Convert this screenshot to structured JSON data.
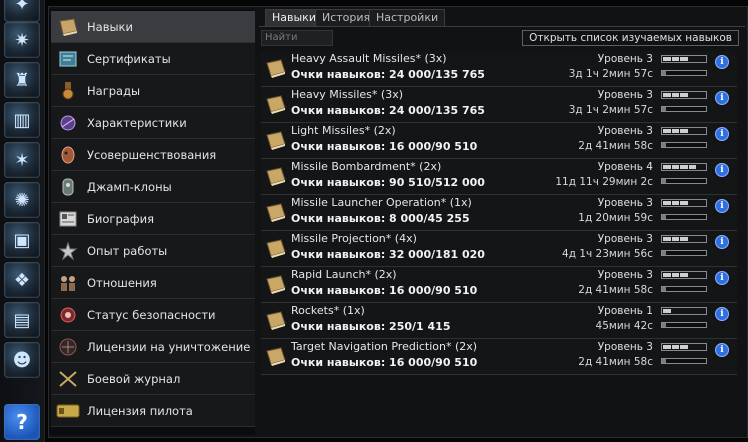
{
  "neocom": {
    "icons": [
      "character-sheet-icon",
      "skills-icon",
      "people-icon",
      "market-icon",
      "agents-icon",
      "star-map-icon",
      "assets-icon",
      "wallet-icon",
      "journal-icon",
      "character-portrait-icon",
      "help-icon"
    ],
    "help_label": "?"
  },
  "sidebar": {
    "items": [
      {
        "label": "Навыки",
        "icon": "skill-book-icon"
      },
      {
        "label": "Сертификаты",
        "icon": "certificate-icon"
      },
      {
        "label": "Награды",
        "icon": "medal-icon"
      },
      {
        "label": "Характеристики",
        "icon": "attributes-icon"
      },
      {
        "label": "Усовершенствования",
        "icon": "augmentations-icon"
      },
      {
        "label": "Джамп-клоны",
        "icon": "jump-clone-icon"
      },
      {
        "label": "Биография",
        "icon": "biography-icon"
      },
      {
        "label": "Опыт работы",
        "icon": "employment-icon"
      },
      {
        "label": "Отношения",
        "icon": "standings-icon"
      },
      {
        "label": "Статус безопасности",
        "icon": "security-status-icon"
      },
      {
        "label": "Лицензии на уничтожение",
        "icon": "kill-rights-icon"
      },
      {
        "label": "Боевой журнал",
        "icon": "combat-log-icon"
      },
      {
        "label": "Лицензия пилота",
        "icon": "pilot-license-icon"
      }
    ]
  },
  "tabs": [
    {
      "label": "Навыки"
    },
    {
      "label": "История"
    },
    {
      "label": "Настройки"
    }
  ],
  "search": {
    "placeholder": "Найти"
  },
  "open_list_button": "Открыть список изучаемых навыков",
  "skills": [
    {
      "name": "Heavy Assault Missiles*  (3x)",
      "points": "Очки навыков: 24 000/135 765",
      "level": "Уровень 3",
      "time": "3д 1ч 2мин 57с",
      "level_num": 3,
      "progress": 0.1
    },
    {
      "name": "Heavy Missiles*  (3x)",
      "points": "Очки навыков: 24 000/135 765",
      "level": "Уровень 3",
      "time": "3д 1ч 2мин 57с",
      "level_num": 3,
      "progress": 0.1
    },
    {
      "name": "Light Missiles*  (2x)",
      "points": "Очки навыков: 16 000/90 510",
      "level": "Уровень 3",
      "time": "2д 41мин 58с",
      "level_num": 3,
      "progress": 0.1
    },
    {
      "name": "Missile Bombardment*  (2x)",
      "points": "Очки навыков: 90 510/512 000",
      "level": "Уровень 4",
      "time": "11д 11ч 29мин 2с",
      "level_num": 4,
      "progress": 0.1
    },
    {
      "name": "Missile Launcher Operation*  (1x)",
      "points": "Очки навыков: 8 000/45 255",
      "level": "Уровень 3",
      "time": "1д 20мин 59с",
      "level_num": 3,
      "progress": 0.1
    },
    {
      "name": "Missile Projection*  (4x)",
      "points": "Очки навыков: 32 000/181 020",
      "level": "Уровень 3",
      "time": "4д 1ч 23мин 56с",
      "level_num": 3,
      "progress": 0.1
    },
    {
      "name": "Rapid Launch*  (2x)",
      "points": "Очки навыков: 16 000/90 510",
      "level": "Уровень 3",
      "time": "2д 41мин 58с",
      "level_num": 3,
      "progress": 0.1
    },
    {
      "name": "Rockets*  (1x)",
      "points": "Очки навыков: 250/1 415",
      "level": "Уровень 1",
      "time": "45мин 42с",
      "level_num": 1,
      "progress": 0.1
    },
    {
      "name": "Target Navigation Prediction*  (2x)",
      "points": "Очки навыков: 16 000/90 510",
      "level": "Уровень 3",
      "time": "2д 41мин 58с",
      "level_num": 3,
      "progress": 0.1
    }
  ],
  "info_label": "i",
  "colors": {
    "accent_info": "#2f6fe0",
    "active_row": "#3a3c3f"
  }
}
